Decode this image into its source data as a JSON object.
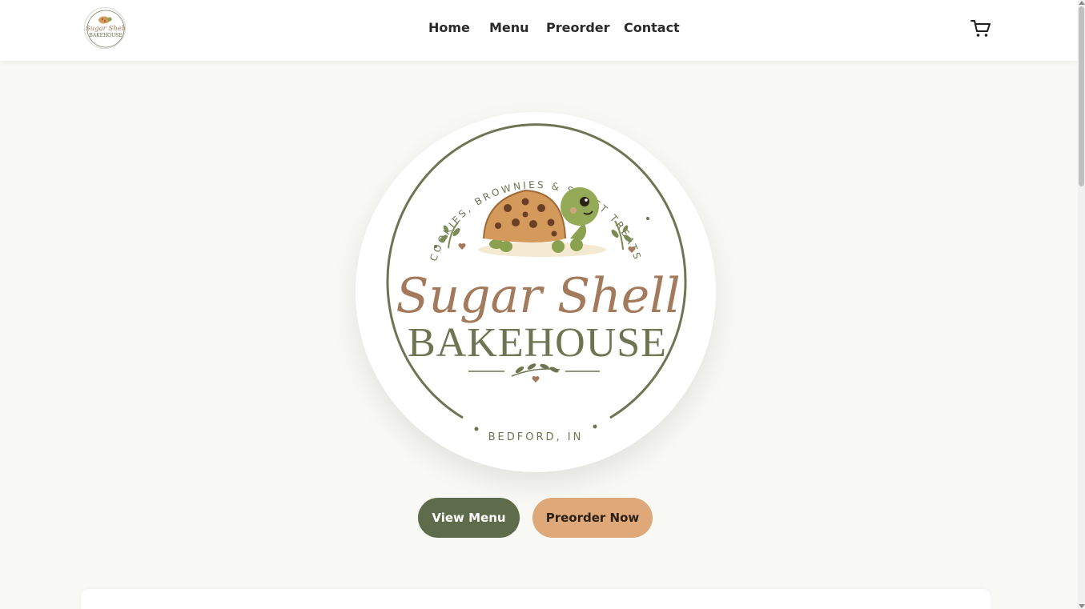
{
  "brand": {
    "name_script": "Sugar Shell",
    "name_serif": "BAKEHOUSE",
    "tagline": "COOKIES, BROWNIES & SWEET TREATS",
    "location": "BEDFORD, IN",
    "small_script": "Sugar Shell",
    "small_serif": "BAKEHOUSE"
  },
  "nav": {
    "items": [
      {
        "label": "Home"
      },
      {
        "label": "Menu"
      },
      {
        "label": "Preorder"
      },
      {
        "label": "Contact"
      }
    ]
  },
  "icons": {
    "cart": "cart-icon",
    "turtle": "turtle-icon",
    "leaf": "leaf-icon",
    "heart": "heart-icon"
  },
  "hero": {
    "primary_button": "View Menu",
    "secondary_button": "Preorder Now"
  },
  "colors": {
    "olive": "#5f6c4b",
    "tan": "#dea878",
    "brown": "#a37b5c",
    "background": "#f8f8f5"
  }
}
